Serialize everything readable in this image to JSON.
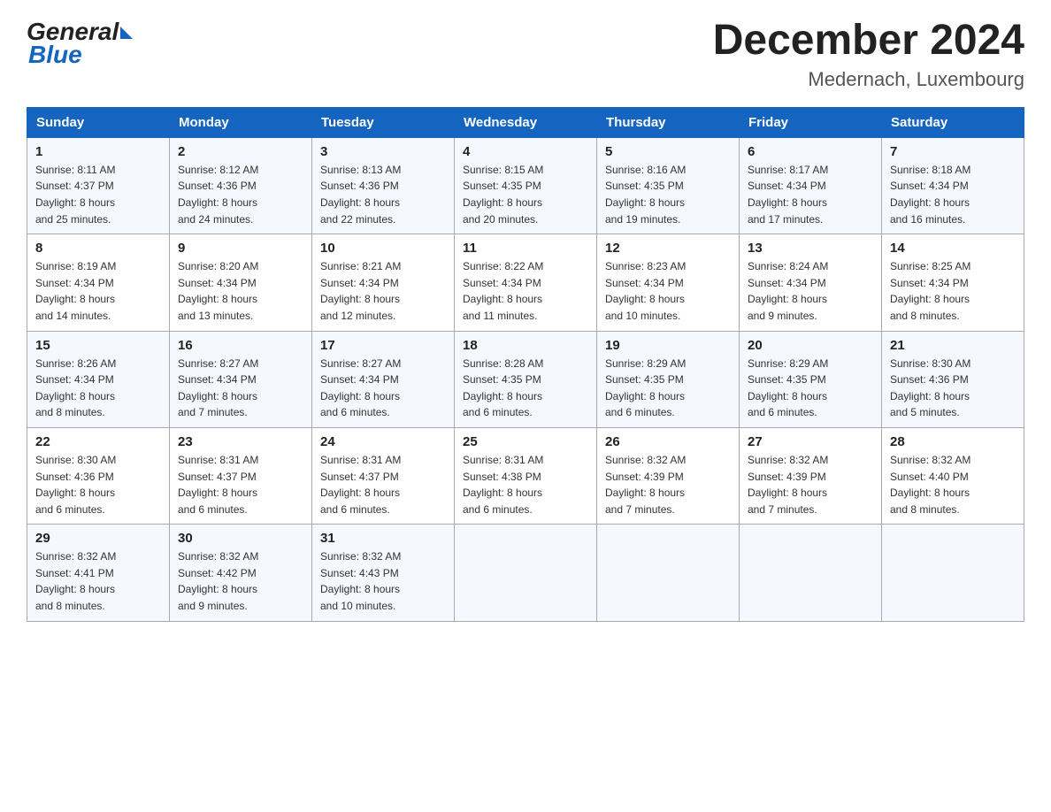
{
  "header": {
    "logo_general": "General",
    "logo_blue": "Blue",
    "month_title": "December 2024",
    "location": "Medernach, Luxembourg"
  },
  "days_of_week": [
    "Sunday",
    "Monday",
    "Tuesday",
    "Wednesday",
    "Thursday",
    "Friday",
    "Saturday"
  ],
  "weeks": [
    [
      {
        "day": "1",
        "sunrise": "8:11 AM",
        "sunset": "4:37 PM",
        "daylight": "8 hours and 25 minutes."
      },
      {
        "day": "2",
        "sunrise": "8:12 AM",
        "sunset": "4:36 PM",
        "daylight": "8 hours and 24 minutes."
      },
      {
        "day": "3",
        "sunrise": "8:13 AM",
        "sunset": "4:36 PM",
        "daylight": "8 hours and 22 minutes."
      },
      {
        "day": "4",
        "sunrise": "8:15 AM",
        "sunset": "4:35 PM",
        "daylight": "8 hours and 20 minutes."
      },
      {
        "day": "5",
        "sunrise": "8:16 AM",
        "sunset": "4:35 PM",
        "daylight": "8 hours and 19 minutes."
      },
      {
        "day": "6",
        "sunrise": "8:17 AM",
        "sunset": "4:34 PM",
        "daylight": "8 hours and 17 minutes."
      },
      {
        "day": "7",
        "sunrise": "8:18 AM",
        "sunset": "4:34 PM",
        "daylight": "8 hours and 16 minutes."
      }
    ],
    [
      {
        "day": "8",
        "sunrise": "8:19 AM",
        "sunset": "4:34 PM",
        "daylight": "8 hours and 14 minutes."
      },
      {
        "day": "9",
        "sunrise": "8:20 AM",
        "sunset": "4:34 PM",
        "daylight": "8 hours and 13 minutes."
      },
      {
        "day": "10",
        "sunrise": "8:21 AM",
        "sunset": "4:34 PM",
        "daylight": "8 hours and 12 minutes."
      },
      {
        "day": "11",
        "sunrise": "8:22 AM",
        "sunset": "4:34 PM",
        "daylight": "8 hours and 11 minutes."
      },
      {
        "day": "12",
        "sunrise": "8:23 AM",
        "sunset": "4:34 PM",
        "daylight": "8 hours and 10 minutes."
      },
      {
        "day": "13",
        "sunrise": "8:24 AM",
        "sunset": "4:34 PM",
        "daylight": "8 hours and 9 minutes."
      },
      {
        "day": "14",
        "sunrise": "8:25 AM",
        "sunset": "4:34 PM",
        "daylight": "8 hours and 8 minutes."
      }
    ],
    [
      {
        "day": "15",
        "sunrise": "8:26 AM",
        "sunset": "4:34 PM",
        "daylight": "8 hours and 8 minutes."
      },
      {
        "day": "16",
        "sunrise": "8:27 AM",
        "sunset": "4:34 PM",
        "daylight": "8 hours and 7 minutes."
      },
      {
        "day": "17",
        "sunrise": "8:27 AM",
        "sunset": "4:34 PM",
        "daylight": "8 hours and 6 minutes."
      },
      {
        "day": "18",
        "sunrise": "8:28 AM",
        "sunset": "4:35 PM",
        "daylight": "8 hours and 6 minutes."
      },
      {
        "day": "19",
        "sunrise": "8:29 AM",
        "sunset": "4:35 PM",
        "daylight": "8 hours and 6 minutes."
      },
      {
        "day": "20",
        "sunrise": "8:29 AM",
        "sunset": "4:35 PM",
        "daylight": "8 hours and 6 minutes."
      },
      {
        "day": "21",
        "sunrise": "8:30 AM",
        "sunset": "4:36 PM",
        "daylight": "8 hours and 5 minutes."
      }
    ],
    [
      {
        "day": "22",
        "sunrise": "8:30 AM",
        "sunset": "4:36 PM",
        "daylight": "8 hours and 6 minutes."
      },
      {
        "day": "23",
        "sunrise": "8:31 AM",
        "sunset": "4:37 PM",
        "daylight": "8 hours and 6 minutes."
      },
      {
        "day": "24",
        "sunrise": "8:31 AM",
        "sunset": "4:37 PM",
        "daylight": "8 hours and 6 minutes."
      },
      {
        "day": "25",
        "sunrise": "8:31 AM",
        "sunset": "4:38 PM",
        "daylight": "8 hours and 6 minutes."
      },
      {
        "day": "26",
        "sunrise": "8:32 AM",
        "sunset": "4:39 PM",
        "daylight": "8 hours and 7 minutes."
      },
      {
        "day": "27",
        "sunrise": "8:32 AM",
        "sunset": "4:39 PM",
        "daylight": "8 hours and 7 minutes."
      },
      {
        "day": "28",
        "sunrise": "8:32 AM",
        "sunset": "4:40 PM",
        "daylight": "8 hours and 8 minutes."
      }
    ],
    [
      {
        "day": "29",
        "sunrise": "8:32 AM",
        "sunset": "4:41 PM",
        "daylight": "8 hours and 8 minutes."
      },
      {
        "day": "30",
        "sunrise": "8:32 AM",
        "sunset": "4:42 PM",
        "daylight": "8 hours and 9 minutes."
      },
      {
        "day": "31",
        "sunrise": "8:32 AM",
        "sunset": "4:43 PM",
        "daylight": "8 hours and 10 minutes."
      },
      null,
      null,
      null,
      null
    ]
  ],
  "labels": {
    "sunrise": "Sunrise:",
    "sunset": "Sunset:",
    "daylight": "Daylight:"
  }
}
